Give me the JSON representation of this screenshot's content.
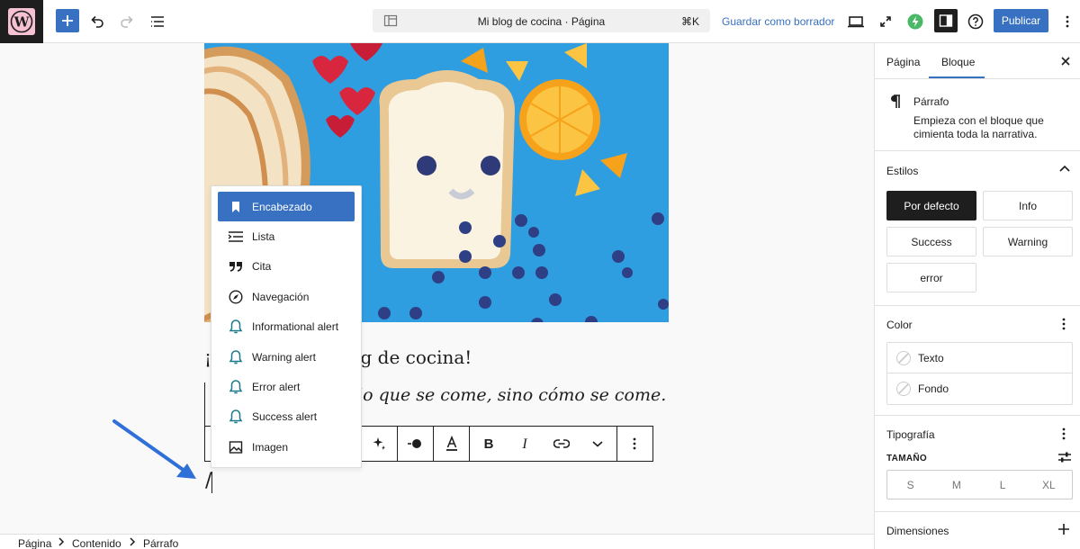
{
  "header": {
    "document_title": "Mi blog de cocina · Página",
    "shortcut": "⌘K",
    "save_draft_label": "Guardar como borrador",
    "publish_label": "Publicar"
  },
  "editor": {
    "heading_visible": "¡",
    "heading_tail": "log de cocina!",
    "subtext_tail": "es lo que se come, sino cómo se come.",
    "slash_text": "/"
  },
  "inserter": {
    "items": [
      {
        "label": "Encabezado",
        "icon": "bookmark-icon",
        "active": true
      },
      {
        "label": "Lista",
        "icon": "list-icon"
      },
      {
        "label": "Cita",
        "icon": "quote-icon"
      },
      {
        "label": "Navegación",
        "icon": "compass-icon"
      },
      {
        "label": "Informational alert",
        "icon": "bell-icon"
      },
      {
        "label": "Warning alert",
        "icon": "bell-icon"
      },
      {
        "label": "Error alert",
        "icon": "bell-icon"
      },
      {
        "label": "Success alert",
        "icon": "bell-icon"
      },
      {
        "label": "Imagen",
        "icon": "image-icon"
      }
    ]
  },
  "breadcrumb": {
    "items": [
      "Página",
      "Contenido",
      "Párrafo"
    ]
  },
  "sidebar": {
    "tabs": [
      "Página",
      "Bloque"
    ],
    "active_tab": "Bloque",
    "block": {
      "name": "Párrafo",
      "description_line1": "Empieza con el bloque que",
      "description_line2": "cimienta toda la narrativa."
    },
    "styles": {
      "title": "Estilos",
      "options": [
        "Por defecto",
        "Info",
        "Success",
        "Warning",
        "error"
      ],
      "selected": "Por defecto"
    },
    "color": {
      "title": "Color",
      "items": [
        "Texto",
        "Fondo"
      ]
    },
    "typography": {
      "title": "Tipografía",
      "size_label": "TAMAÑO",
      "sizes": [
        "S",
        "M",
        "L",
        "XL"
      ]
    },
    "dimensions": {
      "title": "Dimensiones"
    }
  },
  "colors": {
    "accent": "#3871c1",
    "dark": "#1e1e1e",
    "ai_green": "#4ab866"
  }
}
